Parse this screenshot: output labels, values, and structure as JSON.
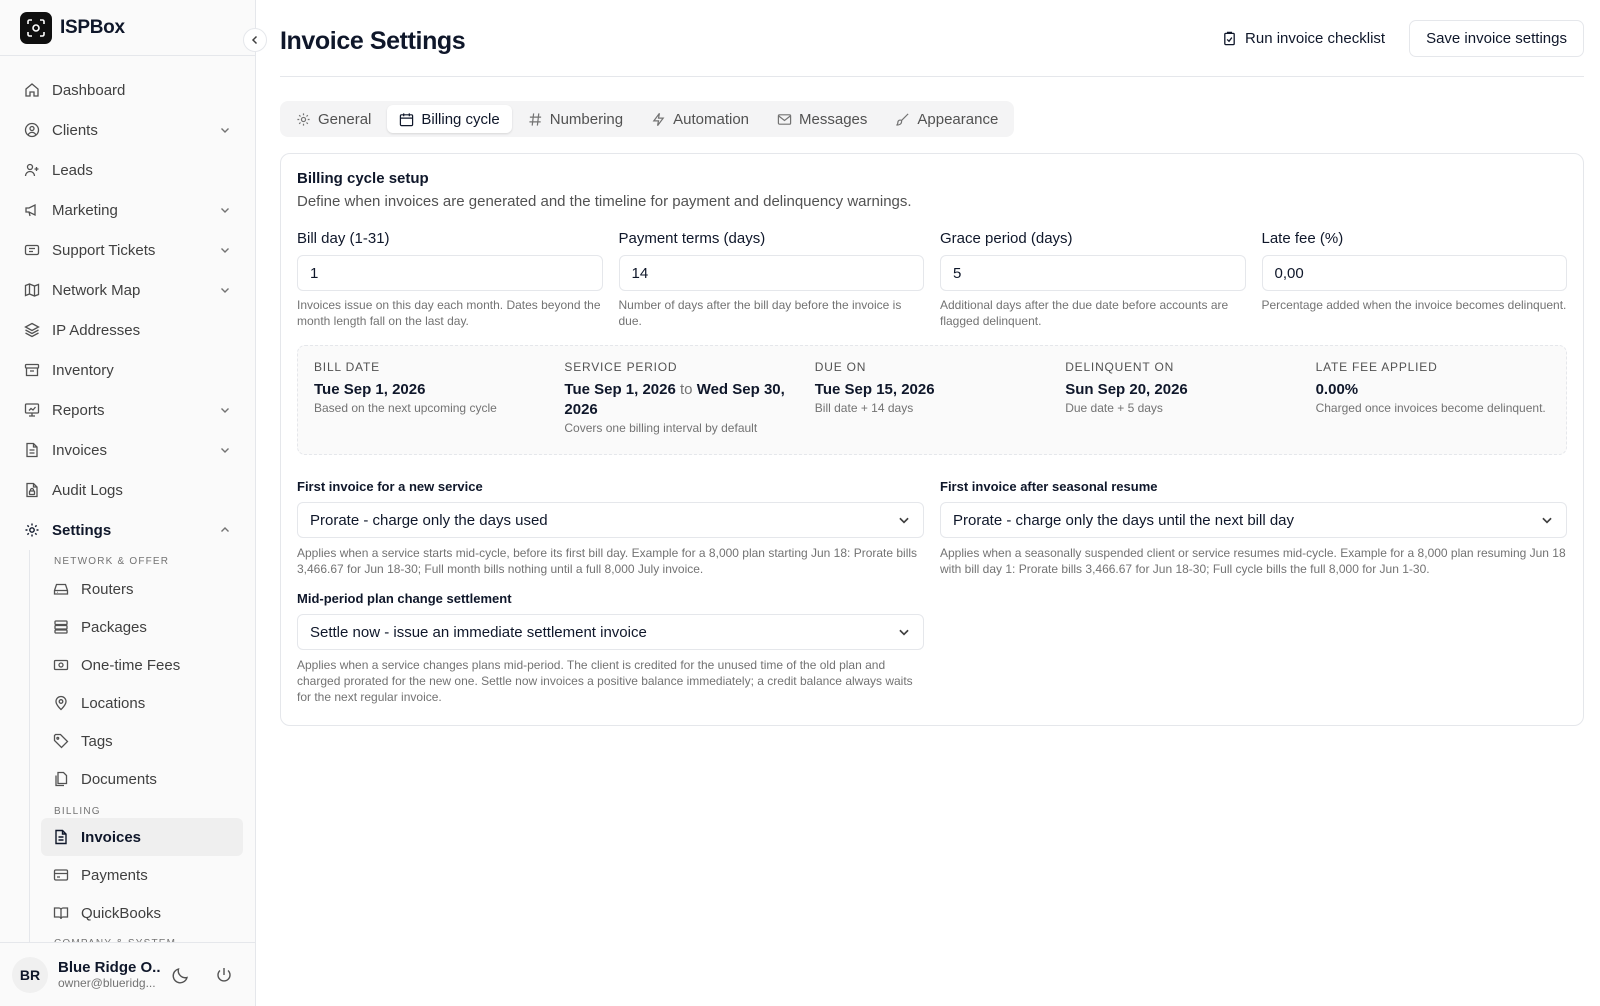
{
  "brand": {
    "name": "ISPBox"
  },
  "nav": {
    "dashboard": "Dashboard",
    "clients": "Clients",
    "leads": "Leads",
    "marketing": "Marketing",
    "support": "Support Tickets",
    "network_map": "Network Map",
    "ip": "IP Addresses",
    "inventory": "Inventory",
    "reports": "Reports",
    "invoices": "Invoices",
    "audit": "Audit Logs",
    "settings": "Settings"
  },
  "settings_menu": {
    "section_network": "NETWORK & OFFER",
    "routers": "Routers",
    "packages": "Packages",
    "one_time_fees": "One-time Fees",
    "locations": "Locations",
    "tags": "Tags",
    "documents": "Documents",
    "section_billing": "BILLING",
    "invoices": "Invoices",
    "payments": "Payments",
    "quickbooks": "QuickBooks",
    "section_company": "COMPANY & SYSTEM"
  },
  "user": {
    "initials": "BR",
    "name": "Blue Ridge O...",
    "email": "owner@blueridg..."
  },
  "header": {
    "title": "Invoice Settings",
    "checklist": "Run invoice checklist",
    "save": "Save invoice settings"
  },
  "tabs": [
    "General",
    "Billing cycle",
    "Numbering",
    "Automation",
    "Messages",
    "Appearance"
  ],
  "card": {
    "title": "Billing cycle setup",
    "desc": "Define when invoices are generated and the timeline for payment and delinquency warnings."
  },
  "fields": [
    {
      "label": "Bill day (1-31)",
      "value": "1",
      "help": "Invoices issue on this day each month. Dates beyond the month length fall on the last day."
    },
    {
      "label": "Payment terms (days)",
      "value": "14",
      "help": "Number of days after the bill day before the invoice is due."
    },
    {
      "label": "Grace period (days)",
      "value": "5",
      "help": "Additional days after the due date before accounts are flagged delinquent."
    },
    {
      "label": "Late fee (%)",
      "value": "0,00",
      "help": "Percentage added when the invoice becomes delinquent."
    }
  ],
  "summary": {
    "bill_date": {
      "label": "BILL DATE",
      "value": "Tue Sep 1, 2026",
      "sub": "Based on the next upcoming cycle"
    },
    "service_period": {
      "label": "SERVICE PERIOD",
      "start": "Tue Sep 1, 2026",
      "to": "to",
      "end": "Wed Sep 30, 2026",
      "sub": "Covers one billing interval by default"
    },
    "due_on": {
      "label": "DUE ON",
      "value": "Tue Sep 15, 2026",
      "sub": "Bill date + 14 days"
    },
    "delinquent_on": {
      "label": "DELINQUENT ON",
      "value": "Sun Sep 20, 2026",
      "sub": "Due date + 5 days"
    },
    "late_fee": {
      "label": "LATE FEE APPLIED",
      "value": "0.00%",
      "sub": "Charged once invoices become delinquent."
    }
  },
  "selects": {
    "new_service": {
      "label": "First invoice for a new service",
      "value": "Prorate - charge only the days used",
      "help": "Applies when a service starts mid-cycle, before its first bill day. Example for a 8,000 plan starting Jun 18: Prorate bills 3,466.67 for Jun 18-30; Full month bills nothing until a full 8,000 July invoice."
    },
    "seasonal": {
      "label": "First invoice after seasonal resume",
      "value": "Prorate - charge only the days until the next bill day",
      "help": "Applies when a seasonally suspended client or service resumes mid-cycle. Example for a 8,000 plan resuming Jun 18 with bill day 1: Prorate bills 3,466.67 for Jun 18-30; Full cycle bills the full 8,000 for Jun 1-30."
    },
    "plan_change": {
      "label": "Mid-period plan change settlement",
      "value": "Settle now - issue an immediate settlement invoice",
      "help": "Applies when a service changes plans mid-period. The client is credited for the unused time of the old plan and charged prorated for the new one. Settle now invoices a positive balance immediately; a credit balance always waits for the next regular invoice."
    }
  }
}
